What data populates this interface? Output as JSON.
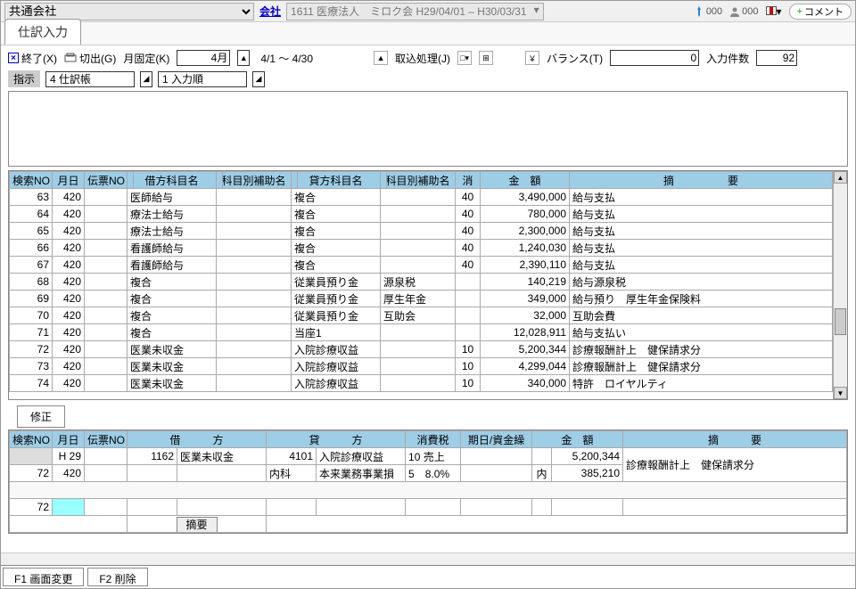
{
  "topbar": {
    "company_label": "共通会社",
    "company_link": "会社",
    "period": "1611 医療法人　ミロク会 H29/04/01 – H30/03/31",
    "stat1": "000",
    "stat2": "000",
    "comment_btn": "コメント"
  },
  "tab": {
    "label": "仕訳入力"
  },
  "toolbar": {
    "close": "終了(X)",
    "cut": "切出(G)",
    "monthfix": "月固定(K)",
    "month": "4月",
    "range": "4/1 ～ 4/30",
    "import": "取込処理(J)",
    "balance_label": "バランス(T)",
    "balance_val": "0",
    "count_label": "入力件数",
    "count_val": "92"
  },
  "instruct": {
    "label": "指示",
    "sel1": "4 仕訳帳",
    "sel2": "1 入力順"
  },
  "grid": {
    "headers": [
      "検索NO",
      "月日",
      "伝票NO",
      "借方科目名",
      "科目別補助名",
      "貸方科目名",
      "科目別補助名",
      "消",
      "金　額",
      "摘　　　　　要"
    ],
    "rows": [
      {
        "no": "63",
        "md": "420",
        "slip": "",
        "dr": "医師給与",
        "drs": "",
        "cr": "複合",
        "crs": "",
        "t": "40",
        "amt": "3,490,000",
        "memo": "給与支払"
      },
      {
        "no": "64",
        "md": "420",
        "slip": "",
        "dr": "療法士給与",
        "drs": "",
        "cr": "複合",
        "crs": "",
        "t": "40",
        "amt": "780,000",
        "memo": "給与支払"
      },
      {
        "no": "65",
        "md": "420",
        "slip": "",
        "dr": "療法士給与",
        "drs": "",
        "cr": "複合",
        "crs": "",
        "t": "40",
        "amt": "2,300,000",
        "memo": "給与支払"
      },
      {
        "no": "66",
        "md": "420",
        "slip": "",
        "dr": "看護師給与",
        "drs": "",
        "cr": "複合",
        "crs": "",
        "t": "40",
        "amt": "1,240,030",
        "memo": "給与支払"
      },
      {
        "no": "67",
        "md": "420",
        "slip": "",
        "dr": "看護師給与",
        "drs": "",
        "cr": "複合",
        "crs": "",
        "t": "40",
        "amt": "2,390,110",
        "memo": "給与支払"
      },
      {
        "no": "68",
        "md": "420",
        "slip": "",
        "dr": "複合",
        "drs": "",
        "cr": "従業員預り金",
        "crs": "源泉税",
        "t": "",
        "amt": "140,219",
        "memo": "給与源泉税"
      },
      {
        "no": "69",
        "md": "420",
        "slip": "",
        "dr": "複合",
        "drs": "",
        "cr": "従業員預り金",
        "crs": "厚生年金",
        "t": "",
        "amt": "349,000",
        "memo": "給与預り　厚生年金保険料"
      },
      {
        "no": "70",
        "md": "420",
        "slip": "",
        "dr": "複合",
        "drs": "",
        "cr": "従業員預り金",
        "crs": "互助会",
        "t": "",
        "amt": "32,000",
        "memo": "互助会費"
      },
      {
        "no": "71",
        "md": "420",
        "slip": "",
        "dr": "複合",
        "drs": "",
        "cr": "当座1",
        "crs": "",
        "t": "",
        "amt": "12,028,911",
        "memo": "給与支払い"
      },
      {
        "no": "72",
        "md": "420",
        "slip": "",
        "dr": "医業未収金",
        "drs": "",
        "cr": "入院診療収益",
        "crs": "",
        "t": "10",
        "amt": "5,200,344",
        "memo": "診療報酬計上　健保請求分"
      },
      {
        "no": "73",
        "md": "420",
        "slip": "",
        "dr": "医業未収金",
        "drs": "",
        "cr": "入院診療収益",
        "crs": "",
        "t": "10",
        "amt": "4,299,044",
        "memo": "診療報酬計上　健保請求分"
      },
      {
        "no": "74",
        "md": "420",
        "slip": "",
        "dr": "医業未収金",
        "drs": "",
        "cr": "入院診療収益",
        "crs": "",
        "t": "10",
        "amt": "340,000",
        "memo": "特許　ロイヤルティ"
      }
    ]
  },
  "correct": "修正",
  "detail": {
    "headers": [
      "検索NO",
      "月日",
      "伝票NO",
      "借　　　方",
      "貸　　　方",
      "消費税",
      "期日/資金繰",
      "金　額",
      "摘　　　要"
    ],
    "r1": {
      "era": "H 29",
      "drcode": "1162",
      "drname": "医業未収金",
      "crcode": "4101",
      "crname": "入院診療収益",
      "tax": "10 売上",
      "amt": "5,200,344",
      "memo": "診療報酬計上　健保請求分"
    },
    "r2": {
      "no": "72",
      "md": "420",
      "drdept": "",
      "crdept": "内科",
      "crsub": "本来業務事業損",
      "taxrate": "5　8.0%",
      "inner": "内",
      "amt": "385,210"
    },
    "r3": {
      "no": "72"
    },
    "memo_btn": "摘要"
  },
  "footer": {
    "f1": "F1 画面変更",
    "f2": "F2 削除"
  }
}
